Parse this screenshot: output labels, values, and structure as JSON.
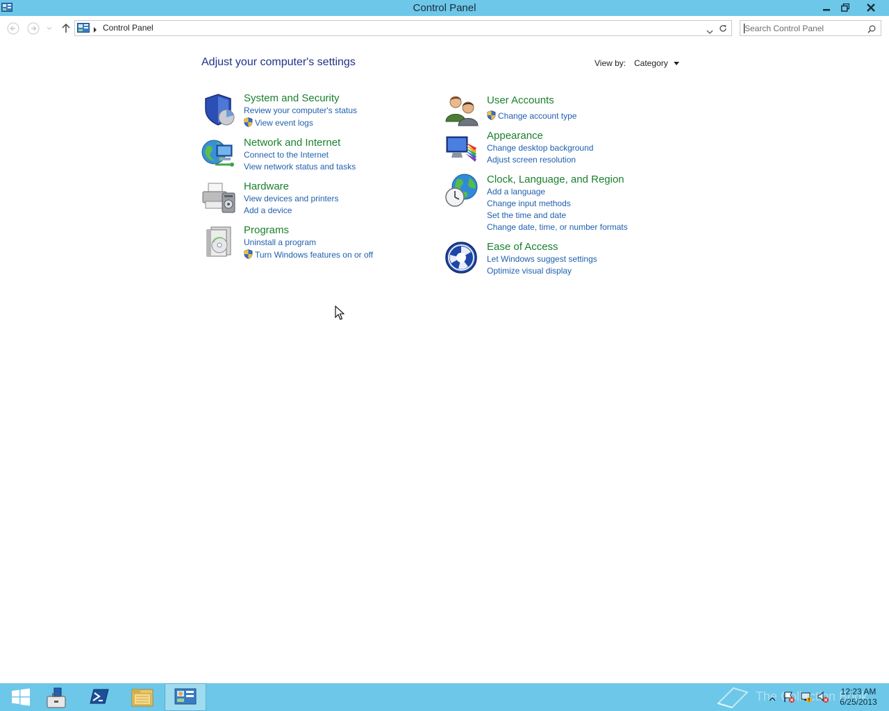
{
  "window": {
    "title": "Control Panel"
  },
  "address": {
    "crumb": "Control Panel"
  },
  "search": {
    "placeholder": "Search Control Panel"
  },
  "content": {
    "heading": "Adjust your computer's settings",
    "view_by_label": "View by:",
    "view_by_value": "Category"
  },
  "categories": [
    {
      "title": "System and Security",
      "icon": "shield-icon",
      "links": [
        {
          "label": "Review your computer's status",
          "shield": false
        },
        {
          "label": "View event logs",
          "shield": true
        }
      ]
    },
    {
      "title": "Network and Internet",
      "icon": "network-globe-icon",
      "links": [
        {
          "label": "Connect to the Internet",
          "shield": false
        },
        {
          "label": "View network status and tasks",
          "shield": false
        }
      ]
    },
    {
      "title": "Hardware",
      "icon": "printer-icon",
      "links": [
        {
          "label": "View devices and printers",
          "shield": false
        },
        {
          "label": "Add a device",
          "shield": false
        }
      ]
    },
    {
      "title": "Programs",
      "icon": "programs-icon",
      "links": [
        {
          "label": "Uninstall a program",
          "shield": false
        },
        {
          "label": "Turn Windows features on or off",
          "shield": true
        }
      ]
    },
    {
      "title": "User Accounts",
      "icon": "users-icon",
      "links": [
        {
          "label": "Change account type",
          "shield": true
        }
      ]
    },
    {
      "title": "Appearance",
      "icon": "appearance-icon",
      "links": [
        {
          "label": "Change desktop background",
          "shield": false
        },
        {
          "label": "Adjust screen resolution",
          "shield": false
        }
      ]
    },
    {
      "title": "Clock, Language, and Region",
      "icon": "clock-globe-icon",
      "links": [
        {
          "label": "Add a language",
          "shield": false
        },
        {
          "label": "Change input methods",
          "shield": false
        },
        {
          "label": "Set the time and date",
          "shield": false
        },
        {
          "label": "Change date, time, or number formats",
          "shield": false
        }
      ]
    },
    {
      "title": "Ease of Access",
      "icon": "ease-of-access-icon",
      "links": [
        {
          "label": "Let Windows suggest settings",
          "shield": false
        },
        {
          "label": "Optimize visual display",
          "shield": false
        }
      ]
    }
  ],
  "taskbar": {
    "time": "12:23 AM",
    "date": "6/25/2013",
    "watermark": "The Collection Book"
  },
  "colors": {
    "titlebar": "#6dc7e8",
    "category_title": "#1a7f2d",
    "link": "#1f5fad",
    "heading": "#1e3287"
  }
}
